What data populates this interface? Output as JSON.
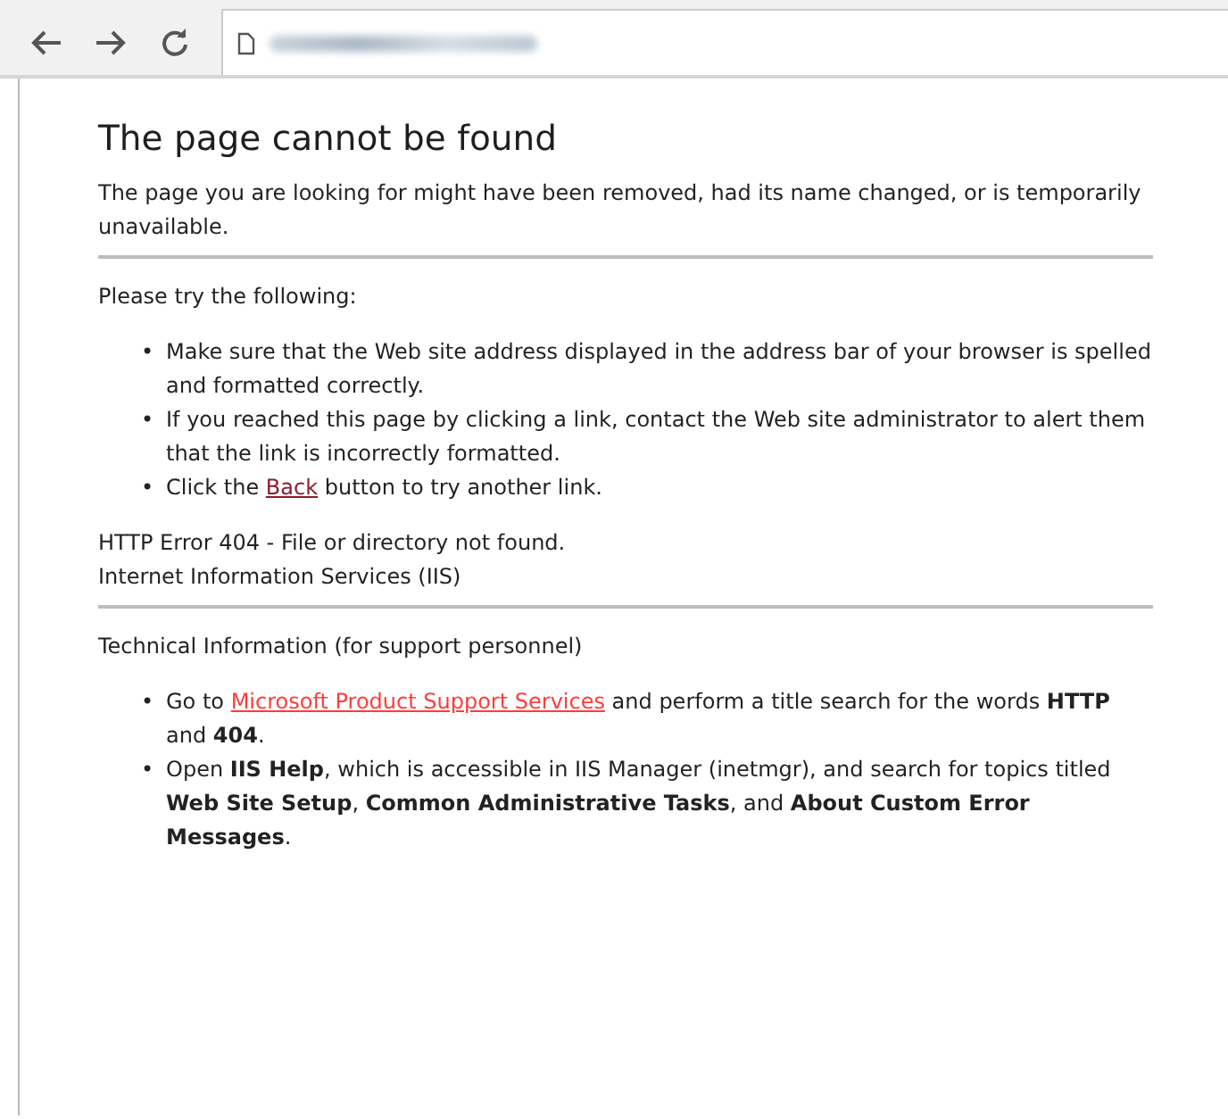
{
  "title": "The page cannot be found",
  "intro": "The page you are looking for might have been removed, had its name changed, or is temporarily unavailable.",
  "try_heading": "Please try the following:",
  "try_items": [
    {
      "marker": "•",
      "parts": [
        {
          "kind": "text",
          "text": "Make sure that the Web site address displayed in the address bar of your browser is spelled and formatted correctly."
        }
      ]
    },
    {
      "marker": "•",
      "parts": [
        {
          "kind": "text",
          "text": "If you reached this page by clicking a link, contact the Web site administrator to alert them that the link is incorrectly formatted."
        }
      ]
    },
    {
      "marker": "•",
      "parts": [
        {
          "kind": "text",
          "text": "Click the "
        },
        {
          "kind": "link",
          "text": "Back",
          "visited": true
        },
        {
          "kind": "text",
          "text": " button to try another link."
        }
      ]
    }
  ],
  "error_lines": [
    "HTTP Error 404 - File or directory not found.",
    "Internet Information Services (IIS)"
  ],
  "tech_heading": "Technical Information (for support personnel)",
  "tech_items": [
    {
      "marker": "•",
      "parts": [
        {
          "kind": "text",
          "text": "Go to "
        },
        {
          "kind": "link",
          "text": "Microsoft Product Support Services",
          "visited": false
        },
        {
          "kind": "text",
          "text": " and perform a title search for the words **HTTP** and **404**."
        }
      ]
    },
    {
      "marker": "•",
      "parts": [
        {
          "kind": "text",
          "text": "Open **IIS Help**, which is accessible in IIS Manager (inetmgr), and search for topics titled **Web Site Setup**, **Common Administrative Tasks**, and **About Custom Error Messages**."
        }
      ]
    }
  ]
}
